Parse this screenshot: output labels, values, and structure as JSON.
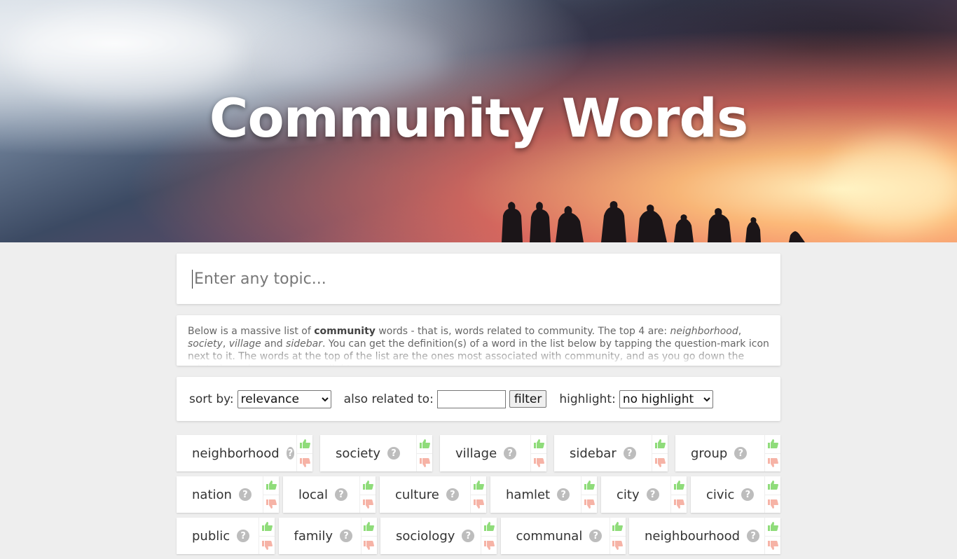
{
  "hero": {
    "title": "Community Words"
  },
  "search": {
    "placeholder": "Enter any topic..."
  },
  "description": {
    "part1": "Below is a massive list of ",
    "bold_word": "community",
    "part2": " words - that is, words related to community. The top 4 are: ",
    "top1": "neighborhood",
    "sep1": ", ",
    "top2": "society",
    "sep2": ", ",
    "top3": "village",
    "sep3": " and ",
    "top4": "sidebar",
    "part3": ". You can get the definition(s) of a word in the list below by tapping the question-mark icon next to it. The words at the top of the list are the ones most associated with community, and as you go down the relatedness becomes more slight."
  },
  "controls": {
    "sort_label": "sort by:",
    "sort_value": "relevance",
    "related_label": "also related to:",
    "related_value": "",
    "filter_label": "filter",
    "highlight_label": "highlight:",
    "highlight_value": "no highlight"
  },
  "icons": {
    "question": "question-mark-icon",
    "upvote": "thumbs-up-icon",
    "downvote": "thumbs-down-icon"
  },
  "colors": {
    "upvote": "#8fdc7a",
    "downvote": "#f6b3a6",
    "question_bg": "#bdbdbd"
  },
  "word_rows": [
    [
      "neighborhood",
      "society",
      "village",
      "sidebar",
      "group"
    ],
    [
      "nation",
      "local",
      "culture",
      "hamlet",
      "city",
      "civic"
    ],
    [
      "public",
      "family",
      "sociology",
      "communal",
      "neighbourhood"
    ]
  ]
}
